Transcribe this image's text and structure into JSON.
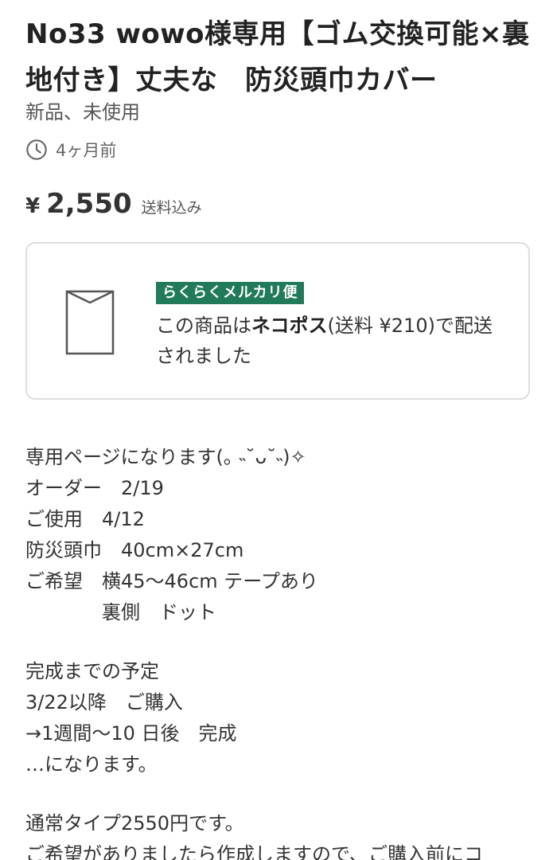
{
  "item": {
    "title": "No33 wowo様専用【ゴム交換可能×裏地付き】丈夫な　防災頭巾カバー",
    "condition": "新品、未使用",
    "posted_ago": "4ヶ月前",
    "price_currency": "¥",
    "price": "2,550",
    "shipping_included": "送料込み"
  },
  "shipping": {
    "badge": "らくらくメルカリ便",
    "text_before": "この商品は",
    "method": "ネコポス",
    "text_after": "(送料 ¥210)で配送されました"
  },
  "description": {
    "lines": [
      "専用ページになります(｡ ˵˘ᴗ˘˵)✧",
      "オーダー　2/19",
      "ご使用　4/12",
      "防災頭巾　40cm×27cm",
      "ご希望　横45〜46cm テープあり",
      "　　　　裏側　ドット",
      "",
      "完成までの予定",
      "3/22以降　ご購入",
      "→1週間〜10 日後　完成",
      "…になります。",
      "",
      "通常タイプ2550円です。",
      "ご希望がありましたら作成しますので、ご購入前にコ"
    ]
  },
  "icons": {
    "clock": "clock-icon",
    "envelope": "envelope-icon"
  },
  "colors": {
    "badge_bg": "#217a5a",
    "card_border": "#dddddd"
  }
}
